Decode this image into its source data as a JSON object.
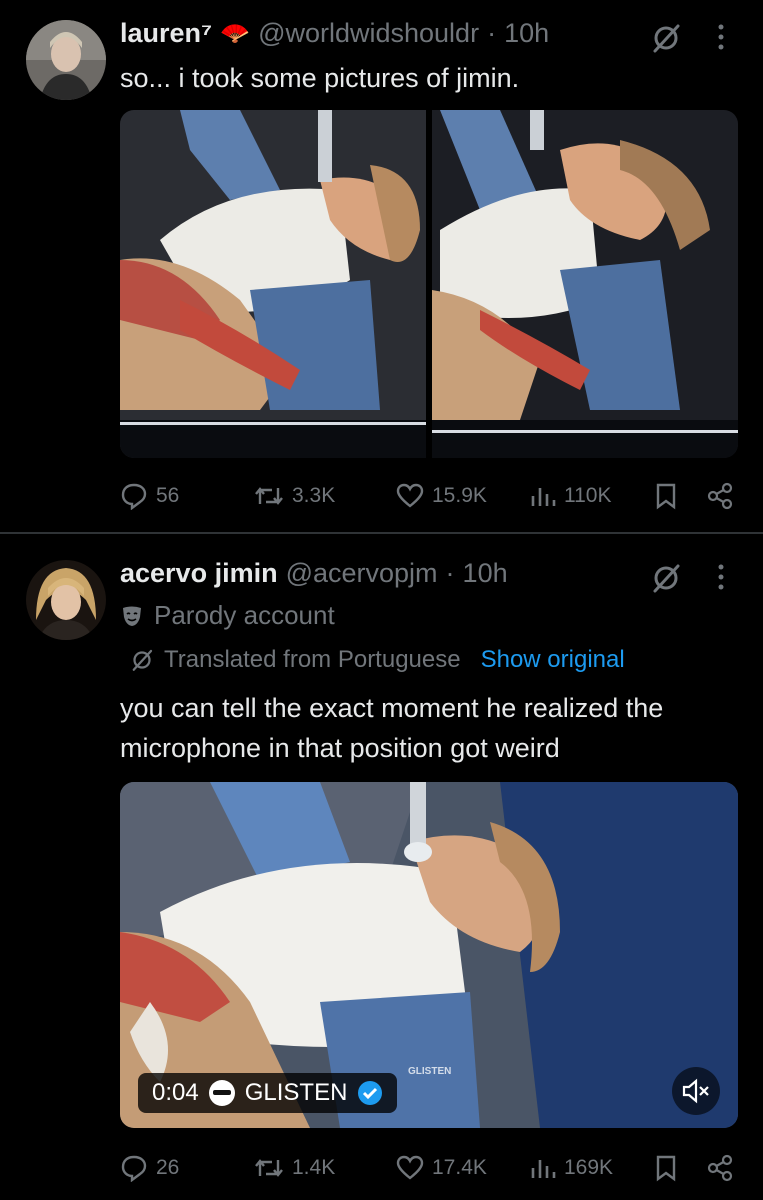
{
  "tweets": [
    {
      "name": "lauren⁷",
      "emoji": "🪭",
      "handle": "@worldwidshouldr",
      "dot": "·",
      "time": "10h",
      "text": "so... i took some pictures of jimin.",
      "stats": {
        "replies": "56",
        "reposts": "3.3K",
        "likes": "15.9K",
        "views": "110K"
      }
    },
    {
      "name": "acervo jimin",
      "handle": "@acervopjm",
      "dot": "·",
      "time": "10h",
      "parody_label": "Parody account",
      "translated_label": "Translated from Portuguese",
      "show_original": "Show original",
      "text_line1": "you can tell the exact moment he realized the",
      "text_line2": "microphone in that position got weird",
      "video": {
        "time": "0:04",
        "channel": "GLISTEN",
        "watermark": "GLISTEN"
      },
      "stats": {
        "replies": "26",
        "reposts": "1.4K",
        "likes": "17.4K",
        "views": "169K"
      }
    }
  ],
  "colors": {
    "bg": "#000000",
    "text": "#e7e9ea",
    "muted": "#71767b",
    "link": "#1d9bf0",
    "divider": "#2f3336"
  },
  "icons": [
    "grok-icon",
    "more-icon",
    "reply-icon",
    "repost-icon",
    "like-icon",
    "views-icon",
    "bookmark-icon",
    "share-icon",
    "parody-icon",
    "translate-icon",
    "verified-icon",
    "mute-icon"
  ]
}
